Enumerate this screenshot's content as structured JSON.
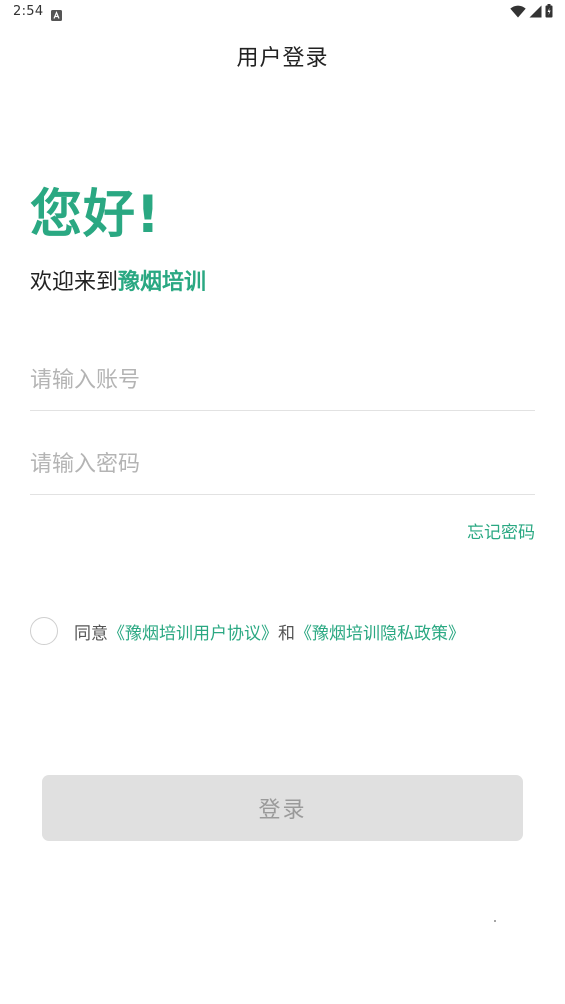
{
  "status_bar": {
    "time": "2:54",
    "icons": [
      "notification-a-icon",
      "wifi-icon",
      "signal-icon",
      "battery-icon"
    ]
  },
  "header": {
    "title": "用户登录"
  },
  "greeting": {
    "hello": "您好!",
    "welcome_prefix": "欢迎来到",
    "brand": "豫烟培训"
  },
  "form": {
    "account_placeholder": "请输入账号",
    "account_value": "",
    "password_placeholder": "请输入密码",
    "password_value": "",
    "forgot_label": "忘记密码"
  },
  "agreement": {
    "checked": false,
    "prefix": "同意",
    "user_agreement": "《豫烟培训用户协议》",
    "conjunction": "和",
    "privacy_policy": "《豫烟培训隐私政策》"
  },
  "login_button": {
    "label": "登录",
    "enabled": false
  },
  "colors": {
    "accent": "#2aa882",
    "button_bg_disabled": "#e0e0e0",
    "button_text_disabled": "#9a9a9a",
    "placeholder": "#b4b4b4",
    "divider": "#e2e2e2"
  }
}
